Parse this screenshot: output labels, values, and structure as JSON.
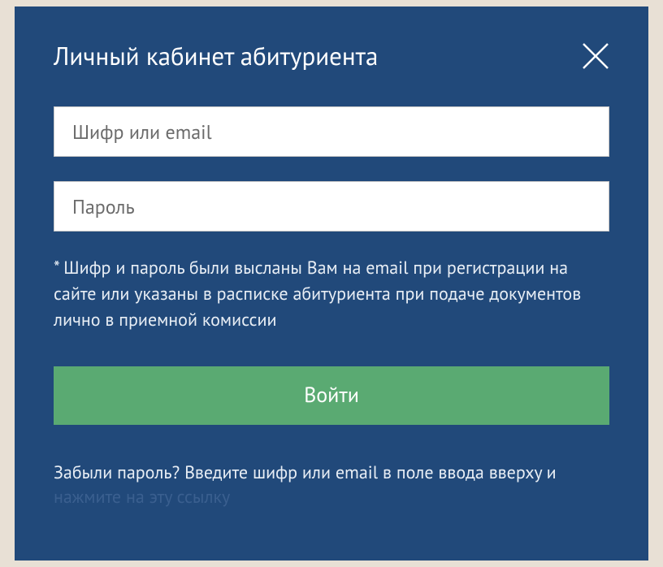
{
  "modal": {
    "title": "Личный кабинет абитуриента",
    "login_input": {
      "placeholder": "Шифр или email",
      "value": ""
    },
    "password_input": {
      "placeholder": "Пароль",
      "value": ""
    },
    "info_text": "* Шифр и пароль были высланы Вам на email при регистрации на сайте или указаны в расписке абитуриента при подаче документов лично в приемной комиссии",
    "login_button_label": "Войти",
    "forgot_prefix": "Забыли пароль? Введите шифр или email в поле ввода вверху и ",
    "forgot_link_label": "нажмите на эту ссылку"
  }
}
